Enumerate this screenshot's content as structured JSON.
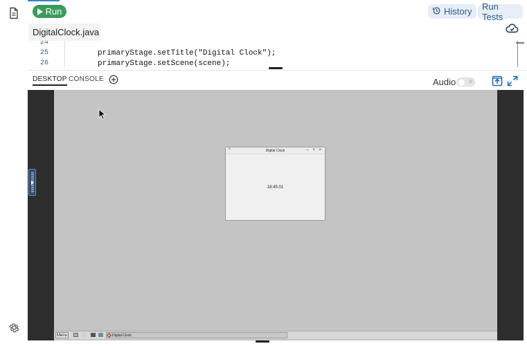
{
  "toolbar": {
    "run_label": "Run",
    "history_label": "History",
    "run_tests_label": "Run Tests"
  },
  "file_tab": {
    "name": "DigitalClock.java"
  },
  "editor": {
    "lines": [
      {
        "number": "24",
        "code": ""
      },
      {
        "number": "25",
        "code": "primaryStage.setTitle(\"Digital Clock\");"
      },
      {
        "number": "26",
        "code": "primaryStage.setScene(scene);"
      }
    ]
  },
  "panel_tabs": {
    "desktop_label": "DESKTOP",
    "console_label": "CONSOLE",
    "audio_label": "Audio",
    "audio_enabled": false
  },
  "remote_desktop": {
    "window_title": "Digital Clock",
    "title_left": "^",
    "title_controls": "– + ×",
    "clock_value": "18:45:01",
    "taskbar_menu_label": "Menu",
    "taskbar_task_label": "Digital Clock"
  },
  "icons": {
    "file": "file-icon",
    "settings": "gear-icon",
    "cloud": "cloud-sync-icon",
    "history": "history-icon",
    "add": "plus-circle-icon",
    "upload": "upload-icon",
    "expand": "expand-icon"
  },
  "colors": {
    "run_button": "#3b9b5e",
    "pill_bg": "#e8eef7",
    "pill_text": "#2a5a8c",
    "desktop_bg": "#c4c4c4"
  }
}
